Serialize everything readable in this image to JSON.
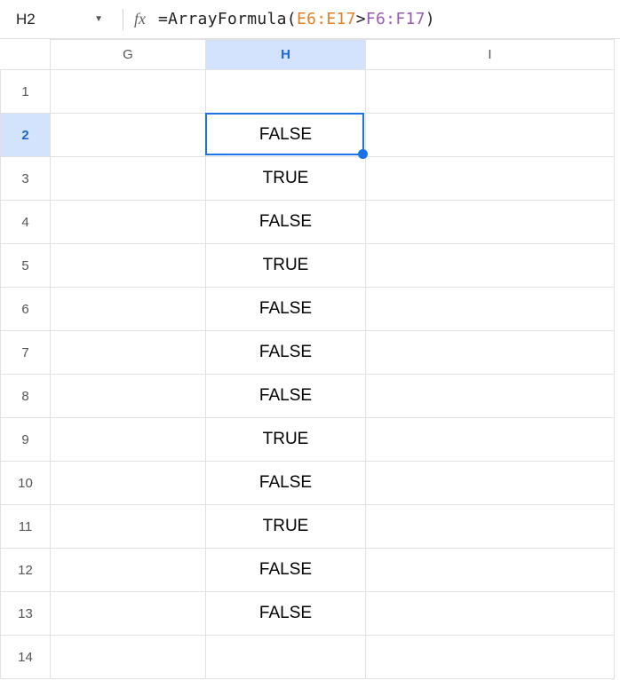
{
  "formula_bar": {
    "cell_ref": "H2",
    "fx_label": "fx",
    "formula_prefix": "=",
    "formula_fn": "ArrayFormula",
    "formula_paren_open": "(",
    "formula_range1": "E6:E17",
    "formula_op": ">",
    "formula_range2": "F6:F17",
    "formula_paren_close": ")"
  },
  "columns": {
    "g": "G",
    "h": "H",
    "i": "I"
  },
  "rows": [
    {
      "num": "1",
      "g": "",
      "h": "",
      "i": ""
    },
    {
      "num": "2",
      "g": "",
      "h": "FALSE",
      "i": ""
    },
    {
      "num": "3",
      "g": "",
      "h": "TRUE",
      "i": ""
    },
    {
      "num": "4",
      "g": "",
      "h": "FALSE",
      "i": ""
    },
    {
      "num": "5",
      "g": "",
      "h": "TRUE",
      "i": ""
    },
    {
      "num": "6",
      "g": "",
      "h": "FALSE",
      "i": ""
    },
    {
      "num": "7",
      "g": "",
      "h": "FALSE",
      "i": ""
    },
    {
      "num": "8",
      "g": "",
      "h": "FALSE",
      "i": ""
    },
    {
      "num": "9",
      "g": "",
      "h": "TRUE",
      "i": ""
    },
    {
      "num": "10",
      "g": "",
      "h": "FALSE",
      "i": ""
    },
    {
      "num": "11",
      "g": "",
      "h": "TRUE",
      "i": ""
    },
    {
      "num": "12",
      "g": "",
      "h": "FALSE",
      "i": ""
    },
    {
      "num": "13",
      "g": "",
      "h": "FALSE",
      "i": ""
    },
    {
      "num": "14",
      "g": "",
      "h": "",
      "i": ""
    }
  ],
  "selected": {
    "row_index": 1,
    "col": "h"
  }
}
